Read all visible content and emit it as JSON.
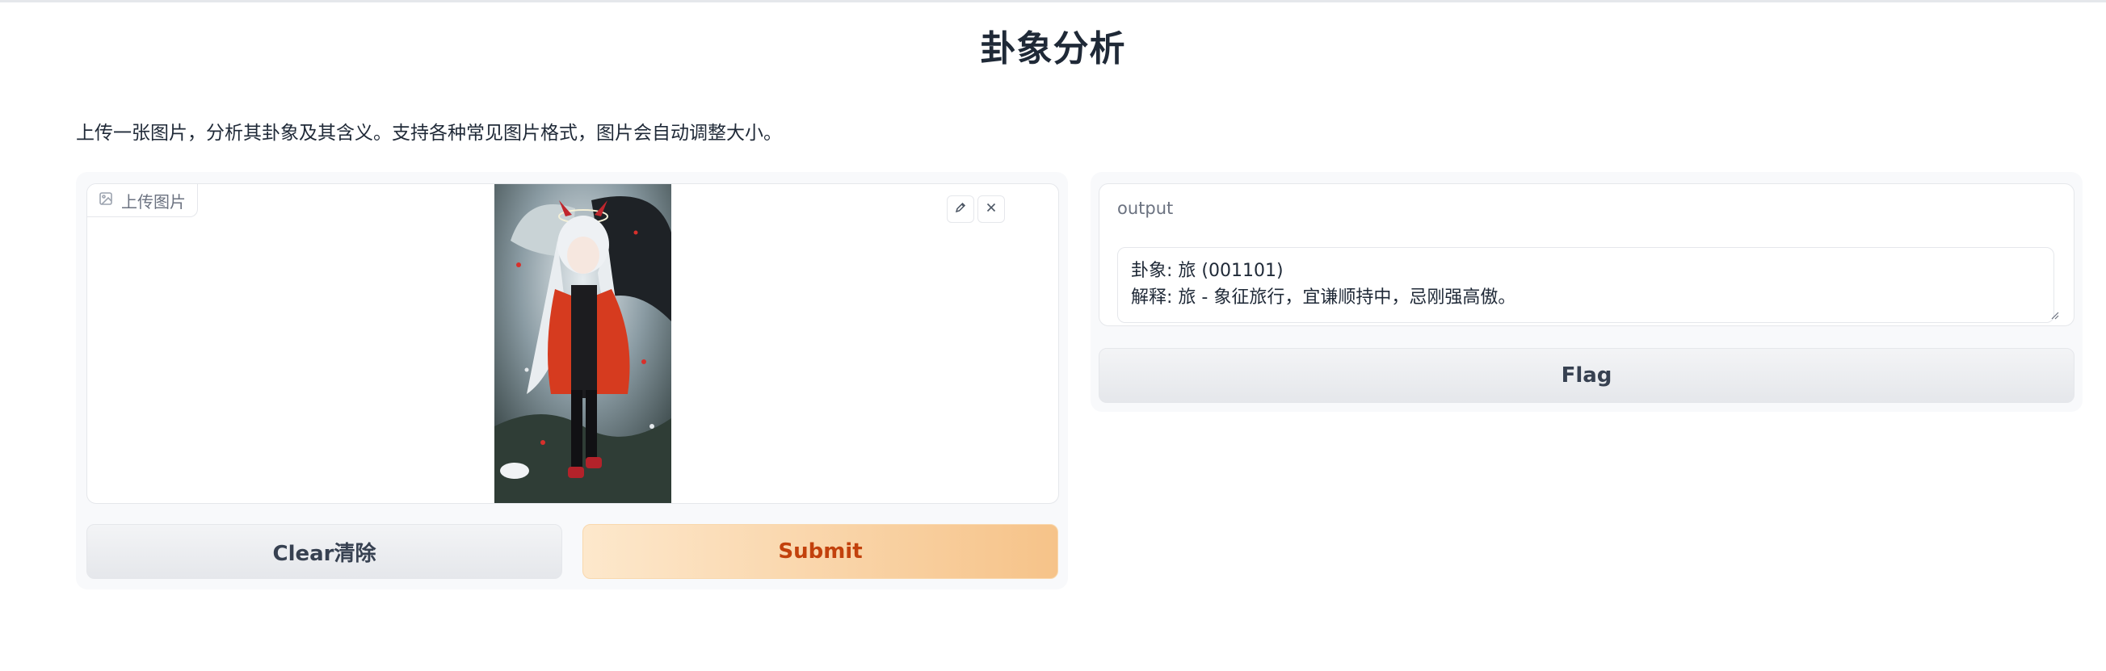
{
  "page": {
    "title": "卦象分析",
    "description": "上传一张图片，分析其卦象及其含义。支持各种常见图片格式，图片会自动调整大小。"
  },
  "image_input": {
    "label": "上传图片",
    "icons": {
      "label": "image-icon",
      "edit": "pencil-icon",
      "clear": "close-icon"
    },
    "image_description": "anime illustration"
  },
  "buttons": {
    "clear": "Clear清除",
    "submit": "Submit",
    "flag": "Flag"
  },
  "output": {
    "label": "output",
    "value": "卦象: 旅 (001101)\n解释: 旅 - 象征旅行，宜谦顺持中，忌刚强高傲。"
  },
  "colors": {
    "submit_start": "#fde8cc",
    "submit_end": "#f6c389",
    "submit_text": "#c2410c"
  }
}
